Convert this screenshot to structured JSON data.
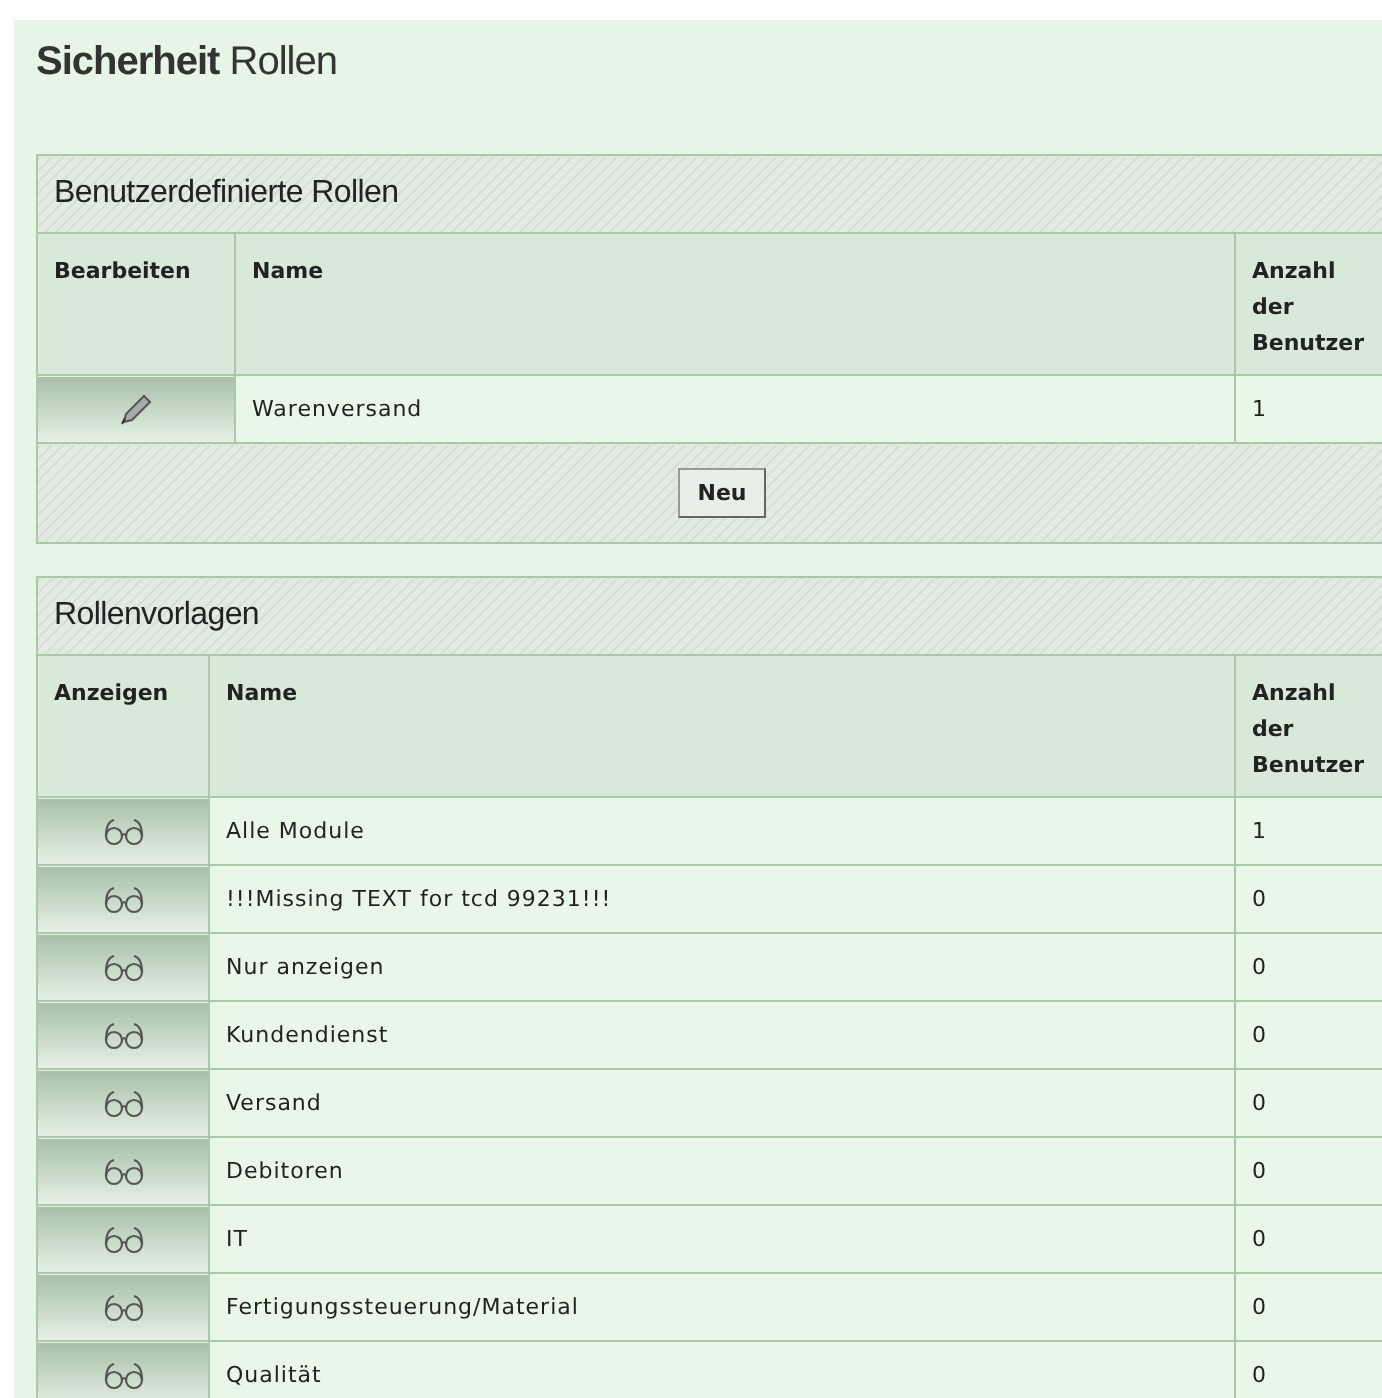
{
  "title": {
    "bold": "Sicherheit",
    "rest": "Rollen"
  },
  "sections": [
    {
      "title": "Benutzerdefinierte Rollen",
      "kind": "edit",
      "columns": [
        "Bearbeiten",
        "Name",
        "Anzahl der Benutzer"
      ],
      "rows": [
        {
          "name": "Warenversand",
          "count": "1"
        }
      ],
      "footer_button": "Neu"
    },
    {
      "title": "Rollenvorlagen",
      "kind": "view",
      "columns": [
        "Anzeigen",
        "Name",
        "Anzahl der Benutzer"
      ],
      "rows": [
        {
          "name": "Alle Module",
          "count": "1"
        },
        {
          "name": "!!!Missing TEXT for tcd 99231!!!",
          "count": "0"
        },
        {
          "name": "Nur anzeigen",
          "count": "0"
        },
        {
          "name": "Kundendienst",
          "count": "0"
        },
        {
          "name": "Versand",
          "count": "0"
        },
        {
          "name": "Debitoren",
          "count": "0"
        },
        {
          "name": "IT",
          "count": "0"
        },
        {
          "name": "Fertigungssteuerung/Material",
          "count": "0"
        },
        {
          "name": "Qualität",
          "count": "0"
        }
      ]
    }
  ]
}
